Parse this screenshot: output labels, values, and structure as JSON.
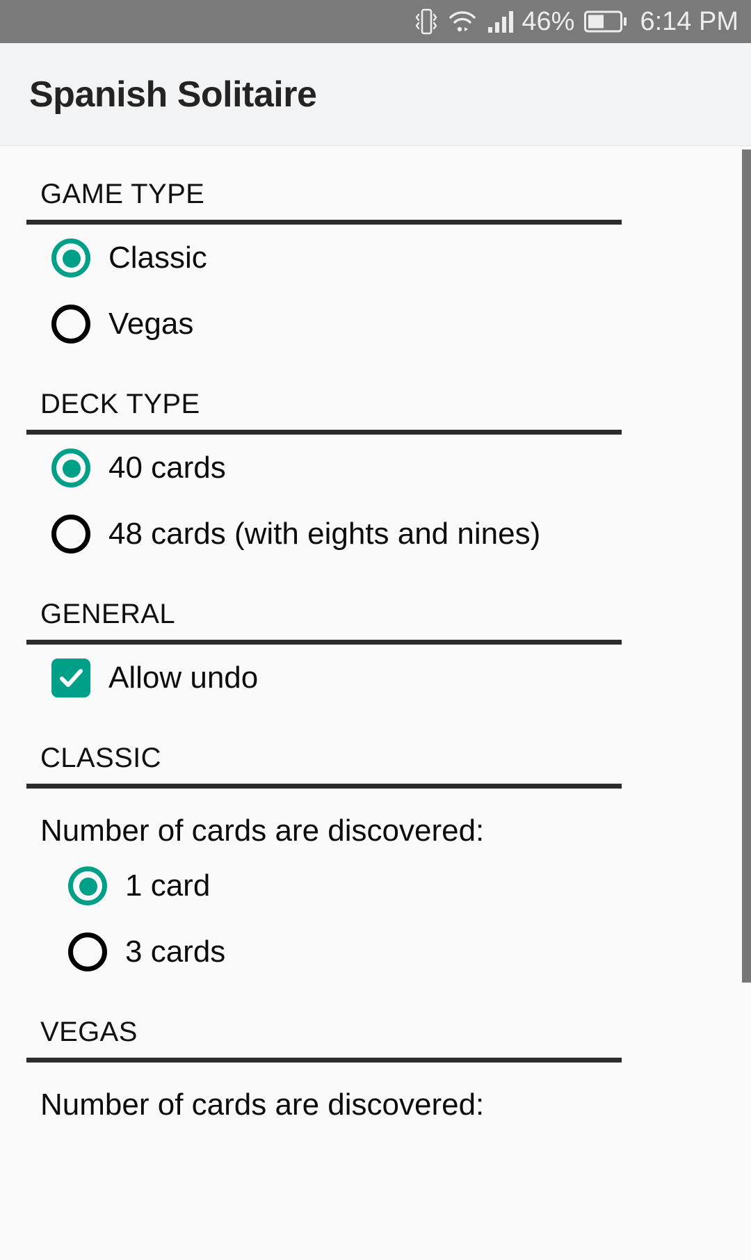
{
  "status_bar": {
    "icons": [
      "vibrate-icon",
      "wifi-icon",
      "signal-icon"
    ],
    "battery_percent": "46%",
    "time": "6:14 PM"
  },
  "app_bar": {
    "title": "Spanish Solitaire"
  },
  "colors": {
    "accent": "#00a088",
    "status_bar_bg": "#7a7a7a",
    "app_bar_bg": "#f2f3f4",
    "content_bg": "#fafafa",
    "divider": "#2c2c2c",
    "scrollbar": "#777777"
  },
  "sections": [
    {
      "header": "GAME TYPE",
      "options": [
        {
          "label": "Classic",
          "type": "radio",
          "checked": true
        },
        {
          "label": "Vegas",
          "type": "radio",
          "checked": false
        }
      ]
    },
    {
      "header": "DECK TYPE",
      "options": [
        {
          "label": "40 cards",
          "type": "radio",
          "checked": true
        },
        {
          "label": "48 cards (with eights and nines)",
          "type": "radio",
          "checked": false
        }
      ]
    },
    {
      "header": "GENERAL",
      "options": [
        {
          "label": "Allow undo",
          "type": "checkbox",
          "checked": true
        }
      ]
    },
    {
      "header": "CLASSIC",
      "pref_text": "Number of cards are discovered:",
      "options": [
        {
          "label": "1 card",
          "type": "radio",
          "checked": true,
          "sub": true
        },
        {
          "label": "3 cards",
          "type": "radio",
          "checked": false,
          "sub": true
        }
      ]
    },
    {
      "header": "VEGAS",
      "pref_text": "Number of cards are discovered:",
      "options": []
    }
  ]
}
